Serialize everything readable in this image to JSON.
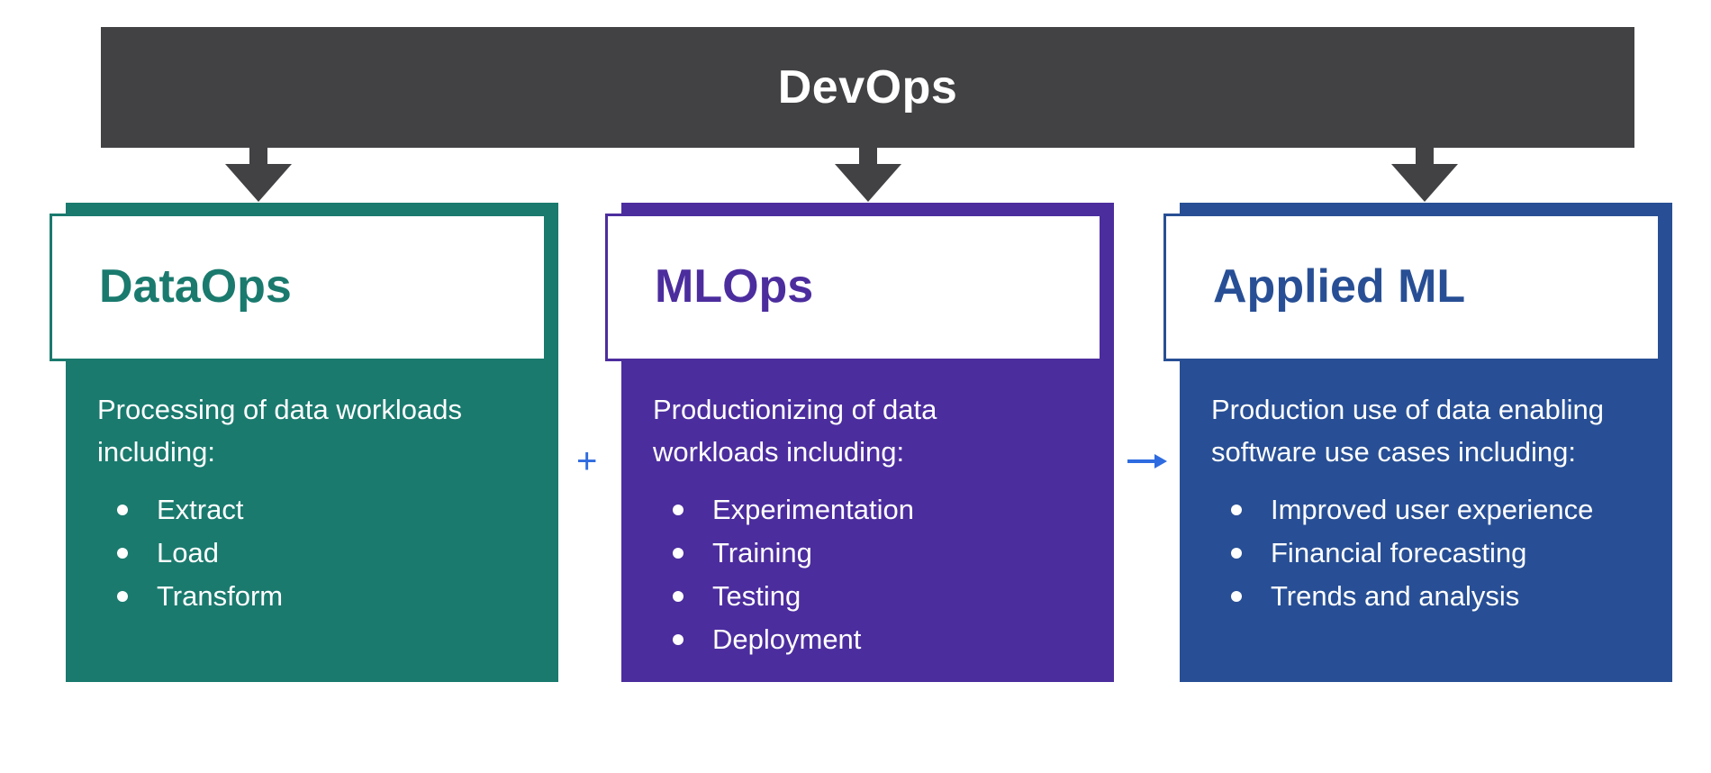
{
  "devops": {
    "title": "DevOps",
    "color": "#424244"
  },
  "connectors": {
    "plus": "+",
    "arrow": "right-arrow-icon",
    "color": "#2e6be0"
  },
  "cards": [
    {
      "title": "DataOps",
      "color": "#1a7a6e",
      "description": "Processing of data workloads including:",
      "items": [
        "Extract",
        "Load",
        "Transform"
      ]
    },
    {
      "title": "MLOps",
      "color": "#4c2d9e",
      "description": "Productionizing of data workloads including:",
      "items": [
        "Experimentation",
        "Training",
        "Testing",
        "Deployment"
      ]
    },
    {
      "title": "Applied ML",
      "color": "#284f95",
      "description": "Production use of data enabling software use cases including:",
      "items": [
        "Improved user experience",
        "Financial forecasting",
        "Trends and analysis"
      ]
    }
  ]
}
